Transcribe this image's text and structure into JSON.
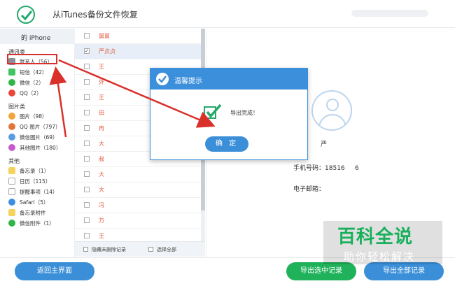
{
  "app": {
    "title": "从iTunes备份文件恢复"
  },
  "sidebar": {
    "device": "的 iPhone",
    "sections": [
      {
        "label": "通讯类",
        "items": [
          {
            "label": "联系人（56）",
            "icon": "contacts-icon"
          },
          {
            "label": "短信（42）",
            "icon": "sms-icon"
          },
          {
            "label": "微信（2）",
            "icon": "wechat-icon"
          },
          {
            "label": "QQ（2）",
            "icon": "qq-icon"
          }
        ]
      },
      {
        "label": "图片类",
        "items": [
          {
            "label": "图片（98）",
            "icon": "photos-icon"
          },
          {
            "label": "QQ 图片（797）",
            "icon": "qq-photos-icon"
          },
          {
            "label": "微信图片（69）",
            "icon": "wechat-photos-icon"
          },
          {
            "label": "其他图片（180）",
            "icon": "other-photos-icon"
          }
        ]
      },
      {
        "label": "其他",
        "items": [
          {
            "label": "备忘录（1）",
            "icon": "notes-icon"
          },
          {
            "label": "日历（115）",
            "icon": "calendar-icon"
          },
          {
            "label": "提醒事项（14）",
            "icon": "reminders-icon"
          },
          {
            "label": "Safari（5）",
            "icon": "safari-icon"
          },
          {
            "label": "备忘录附件",
            "icon": "notes-attach-icon"
          },
          {
            "label": "微信附件（1）",
            "icon": "wechat-attach-icon"
          }
        ]
      }
    ]
  },
  "contacts": [
    {
      "name": "舅舅",
      "checked": false
    },
    {
      "name": "严贞贞",
      "checked": true
    },
    {
      "name": "王",
      "checked": false
    },
    {
      "name": "外",
      "checked": false
    },
    {
      "name": "王",
      "checked": false
    },
    {
      "name": "田",
      "checked": false
    },
    {
      "name": "冉",
      "checked": false
    },
    {
      "name": "大",
      "checked": false
    },
    {
      "name": "叔",
      "checked": false
    },
    {
      "name": "大",
      "checked": false
    },
    {
      "name": "大",
      "checked": false
    },
    {
      "name": "冯",
      "checked": false
    },
    {
      "name": "万",
      "checked": false
    },
    {
      "name": "王",
      "checked": false
    }
  ],
  "list_footer": {
    "hide_deleted": "隐藏未删除记录",
    "select_all": "选择全部"
  },
  "detail": {
    "name": "严",
    "phone_label": "手机号码：",
    "phone_value": "18516     6",
    "email_label": "电子邮箱："
  },
  "footer": {
    "home": "返回主界面",
    "export_selected": "导出选中记录",
    "export_all": "导出全部记录"
  },
  "dialog": {
    "title": "温馨提示",
    "message": "导出完成！",
    "ok": "确 定"
  },
  "watermark": {
    "title": "百科全说",
    "subtitle": "助你轻松解决"
  },
  "colors": {
    "accent": "#3a8fd8",
    "green": "#20b25b",
    "highlight": "#d9302b",
    "contact_text": "#e05a3d"
  }
}
